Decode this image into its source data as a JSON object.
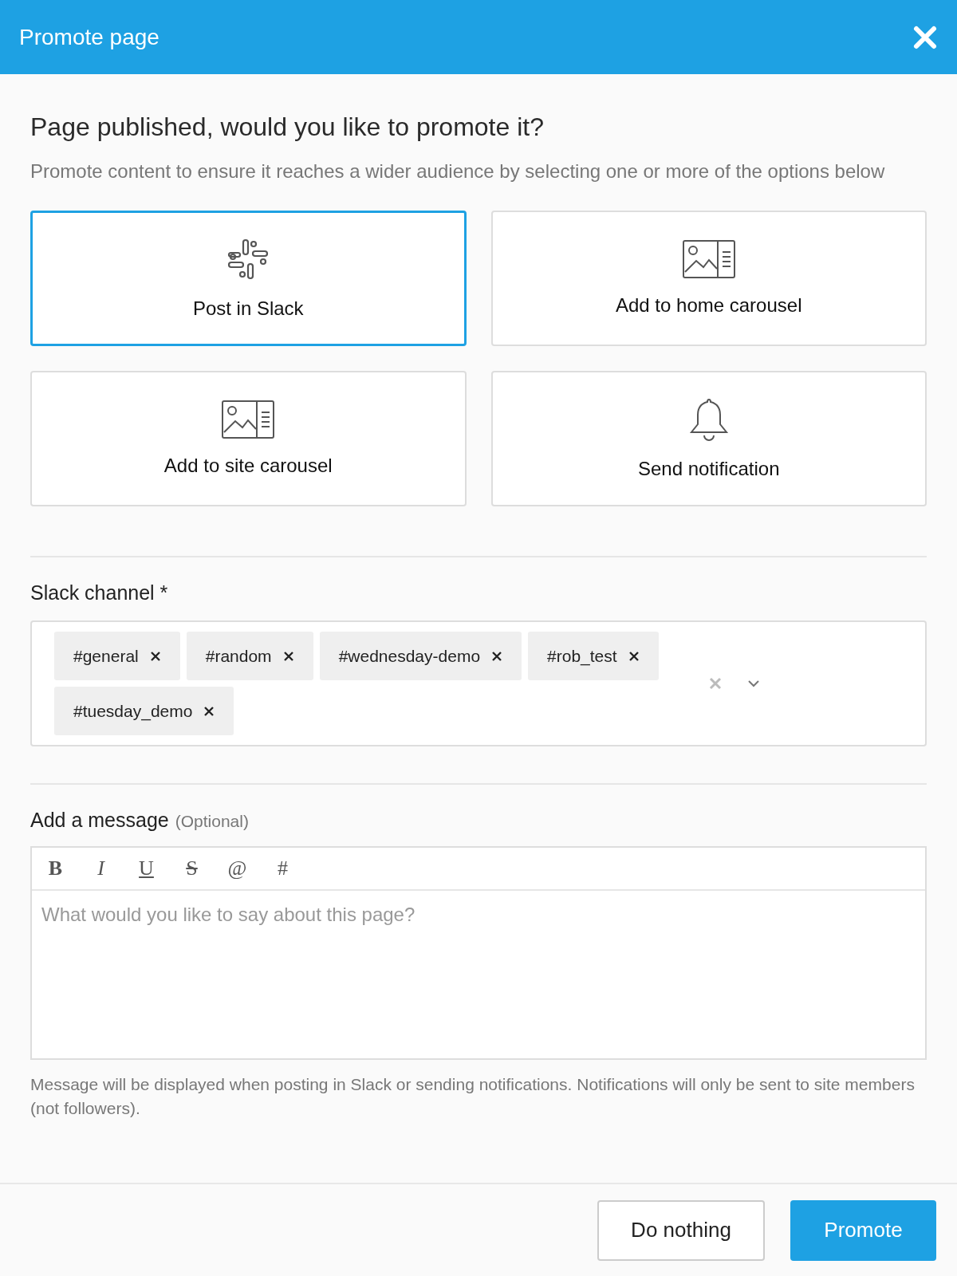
{
  "dialog": {
    "title": "Promote page"
  },
  "heading": "Page published, would you like to promote it?",
  "description": "Promote content to ensure it reaches a wider audience by selecting one or more of the options below",
  "options": [
    {
      "label": "Post in Slack",
      "kind": "slack",
      "selected": true
    },
    {
      "label": "Add to home carousel",
      "kind": "carousel",
      "selected": false
    },
    {
      "label": "Add to site carousel",
      "kind": "carousel",
      "selected": false
    },
    {
      "label": "Send notification",
      "kind": "bell",
      "selected": false
    }
  ],
  "slack_channel": {
    "label": "Slack channel *",
    "tags": [
      "#general",
      "#random",
      "#wednesday-demo",
      "#rob_test",
      "#tuesday_demo"
    ]
  },
  "message": {
    "label": "Add a message",
    "optional": "(Optional)",
    "toolbar": [
      {
        "label": "B",
        "kind": "bold"
      },
      {
        "label": "I",
        "kind": "italic"
      },
      {
        "label": "U",
        "kind": "underline"
      },
      {
        "label": "S",
        "kind": "strike"
      },
      {
        "label": "@",
        "kind": "plain"
      },
      {
        "label": "#",
        "kind": "plain"
      }
    ],
    "placeholder": "What would you like to say about this page?",
    "help": "Message will be displayed when posting in Slack or sending notifications. Notifications will only be sent to site members (not followers)."
  },
  "buttons": [
    {
      "label": "Do nothing",
      "kind": "secondary"
    },
    {
      "label": "Promote",
      "kind": "primary"
    }
  ]
}
